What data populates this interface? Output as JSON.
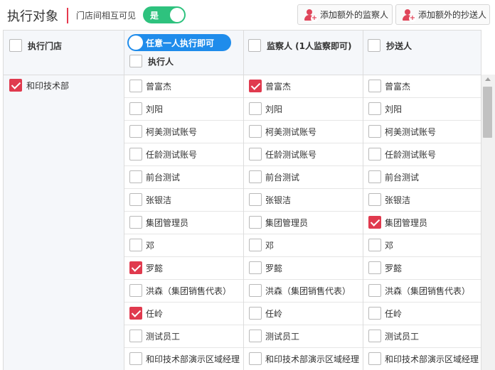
{
  "header": {
    "title": "执行对象",
    "visible_label": "门店间相互可见",
    "toggle_label": "是",
    "toggle_on": true,
    "add_monitor_label": "添加额外的监察人",
    "add_cc_label": "添加额外的抄送人"
  },
  "columns": {
    "store": "执行门店",
    "exec_mode": "任意一人执行即可",
    "exec": "执行人",
    "monitor": "监察人 (1人监察即可)",
    "cc": "抄送人"
  },
  "store": {
    "name": "和印技术部",
    "checked": true
  },
  "people": [
    {
      "name": "曾富杰",
      "exec": false,
      "monitor": true,
      "cc": false
    },
    {
      "name": "刘阳",
      "exec": false,
      "monitor": false,
      "cc": false
    },
    {
      "name": "柯美测试账号",
      "exec": false,
      "monitor": false,
      "cc": false
    },
    {
      "name": "任龄测试账号",
      "exec": false,
      "monitor": false,
      "cc": false
    },
    {
      "name": "前台测试",
      "exec": false,
      "monitor": false,
      "cc": false
    },
    {
      "name": "张银洁",
      "exec": false,
      "monitor": false,
      "cc": false
    },
    {
      "name": "集团管理员",
      "exec": false,
      "monitor": false,
      "cc": true
    },
    {
      "name": "邓",
      "exec": false,
      "monitor": false,
      "cc": false
    },
    {
      "name": "罗懿",
      "exec": true,
      "monitor": false,
      "cc": false
    },
    {
      "name": "洪森（集团销售代表）",
      "exec": false,
      "monitor": false,
      "cc": false
    },
    {
      "name": "任岭",
      "exec": true,
      "monitor": false,
      "cc": false
    },
    {
      "name": "测试员工",
      "exec": false,
      "monitor": false,
      "cc": false
    },
    {
      "name": "和印技术部演示区域经理",
      "exec": false,
      "monitor": false,
      "cc": false
    }
  ],
  "colors": {
    "accent_red": "#e03a4e",
    "toggle_green": "#2ec27e",
    "pill_blue": "#1f8ceb"
  }
}
